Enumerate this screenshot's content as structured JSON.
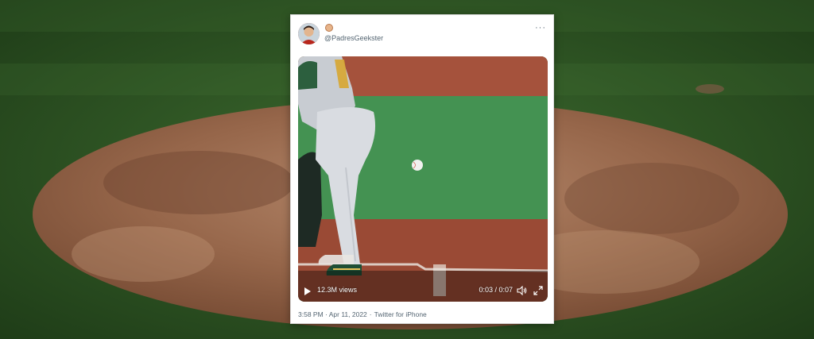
{
  "tweet": {
    "handle": "@PadresGeekster",
    "video": {
      "views": "12.3M views",
      "time": "0:03 / 0:07"
    },
    "timestamp": "3:58 PM · Apr 11, 2022",
    "separator": "·",
    "source": "Twitter for iPhone"
  },
  "icons": {
    "more": "more-horizontal-icon",
    "play": "play-icon",
    "volume": "volume-icon",
    "fullscreen": "expand-icon",
    "badge": "emoji-badge-icon"
  },
  "colors": {
    "grass": "#2f5a26",
    "dirt": "#8a5a3f",
    "card": "#ffffff",
    "secondary_text": "#536471"
  }
}
